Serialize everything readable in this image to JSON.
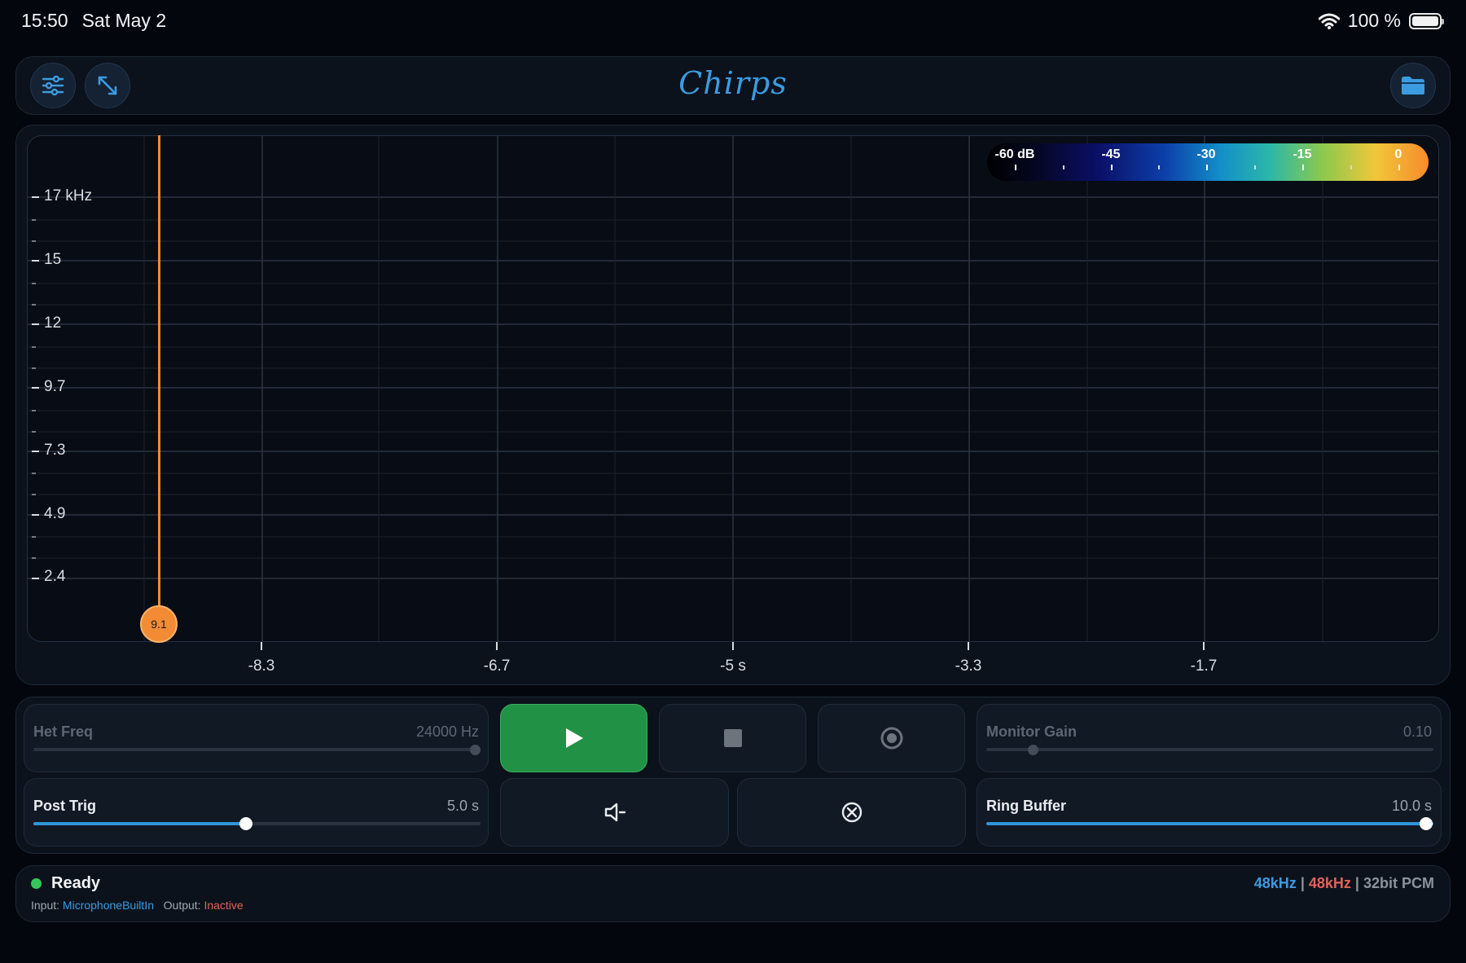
{
  "status_bar": {
    "time": "15:50",
    "date": "Sat May 2",
    "battery": "100 %"
  },
  "app": {
    "title": "Chirps"
  },
  "spectrogram": {
    "y_ticks": [
      "17 kHz",
      "15",
      "12",
      "9.7",
      "7.3",
      "4.9",
      "2.4"
    ],
    "x_ticks": [
      "-8.3",
      "-6.7",
      "-5 s",
      "-3.3",
      "-1.7"
    ],
    "cursor_value": "9.1",
    "colorbar": {
      "labels": [
        "-60 dB",
        "-45",
        "-30",
        "-15",
        "0"
      ]
    },
    "colors": {
      "cursor": "#f08a35",
      "grid": "#2a3443"
    }
  },
  "controls": {
    "het_freq": {
      "label": "Het Freq",
      "value": "24000 Hz",
      "level": 1.0
    },
    "monitor_gain": {
      "label": "Monitor Gain",
      "value": "0.10",
      "level": 0.1
    },
    "post_trig": {
      "label": "Post Trig",
      "value": "5.0 s",
      "level": 0.475
    },
    "ring_buffer": {
      "label": "Ring Buffer",
      "value": "10.0 s",
      "level": 1.0
    }
  },
  "status": {
    "state": "Ready",
    "input_label": "Input:",
    "input_value": "MicrophoneBuiltIn",
    "output_label": "Output:",
    "output_value": "Inactive",
    "rate_in": "48kHz",
    "sep1": "|",
    "rate_out": "48kHz",
    "sep2": "|",
    "format": "32bit PCM"
  },
  "colors": {
    "accent": "#2f95dc",
    "play": "#219145",
    "ready": "#34c759",
    "output_inactive": "#e0645a"
  }
}
